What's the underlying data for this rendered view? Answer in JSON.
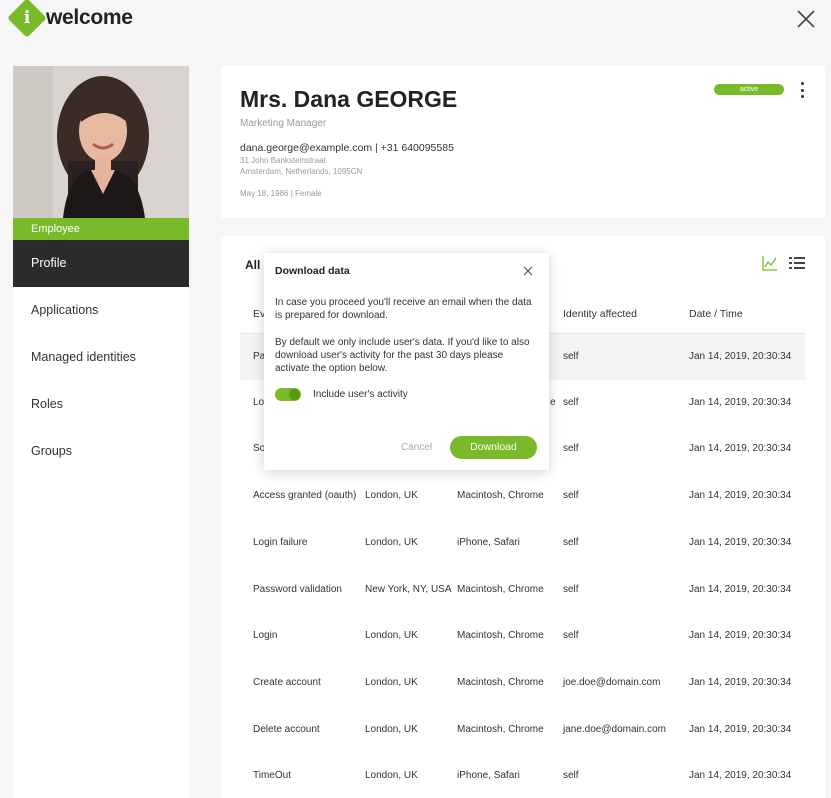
{
  "header": {
    "logo_letter": "i",
    "app_name": "welcome"
  },
  "sidebar": {
    "role": "Employee",
    "items": [
      {
        "label": "Profile"
      },
      {
        "label": "Applications"
      },
      {
        "label": "Managed identities"
      },
      {
        "label": "Roles"
      },
      {
        "label": "Groups"
      }
    ]
  },
  "profile": {
    "name": "Mrs. Dana GEORGE",
    "title": "Marketing Manager",
    "contact": "dana.george@example.com  |  +31 640095585",
    "address_line1": "31 John Banksteinstraat",
    "address_line2": "Amsterdam, Netherlands, 1095CN",
    "meta": "May 18, 1986  |  Female",
    "status": "active"
  },
  "activity": {
    "title": "All",
    "columns": [
      "Ev",
      "Identity affected",
      "Date / Time"
    ],
    "rows": [
      {
        "event": "Pa",
        "location": "",
        "device": "",
        "identity": "self",
        "datetime": "Jan 14, 2019, 20:30:34"
      },
      {
        "event": "Lo",
        "location": "",
        "device": "e",
        "identity": "self",
        "datetime": "Jan 14, 2019, 20:30:34"
      },
      {
        "event": "So",
        "location": "",
        "device": "",
        "identity": "self",
        "datetime": "Jan 14, 2019, 20:30:34"
      },
      {
        "event": "Access granted (oauth)",
        "location": "London, UK",
        "device": "Macintosh, Chrome",
        "identity": "self",
        "datetime": "Jan 14, 2019, 20:30:34"
      },
      {
        "event": "Login failure",
        "location": "London, UK",
        "device": "iPhone, Safari",
        "identity": "self",
        "datetime": "Jan 14, 2019, 20:30:34"
      },
      {
        "event": "Password validation",
        "location": "New York, NY, USA",
        "device": "Macintosh, Chrome",
        "identity": "self",
        "datetime": "Jan 14, 2019, 20:30:34"
      },
      {
        "event": "Login",
        "location": "London, UK",
        "device": "Macintosh, Chrome",
        "identity": "self",
        "datetime": "Jan 14, 2019, 20:30:34"
      },
      {
        "event": "Create account",
        "location": "London, UK",
        "device": "Macintosh, Chrome",
        "identity": "joe.doe@domain.com",
        "datetime": "Jan 14, 2019, 20:30:34"
      },
      {
        "event": "Delete account",
        "location": "London, UK",
        "device": "Macintosh, Chrome",
        "identity": "jane.doe@domain.com",
        "datetime": "Jan 14, 2019, 20:30:34"
      },
      {
        "event": "TimeOut",
        "location": "London, UK",
        "device": "iPhone, Safari",
        "identity": "self",
        "datetime": "Jan 14, 2019, 20:30:34"
      }
    ]
  },
  "modal": {
    "title": "Download data",
    "paragraph1": "In case you proceed you'll receive an email when the data is prepared for download.",
    "paragraph2": "By default we only include user's data. If you'd like to also download user's activity for the past 30 days please activate the option below.",
    "toggle_label": "Include user's activity",
    "toggle_on": true,
    "cancel_label": "Cancel",
    "download_label": "Download"
  },
  "colors": {
    "accent": "#7ab929",
    "nav_active": "#2b2b2b"
  }
}
